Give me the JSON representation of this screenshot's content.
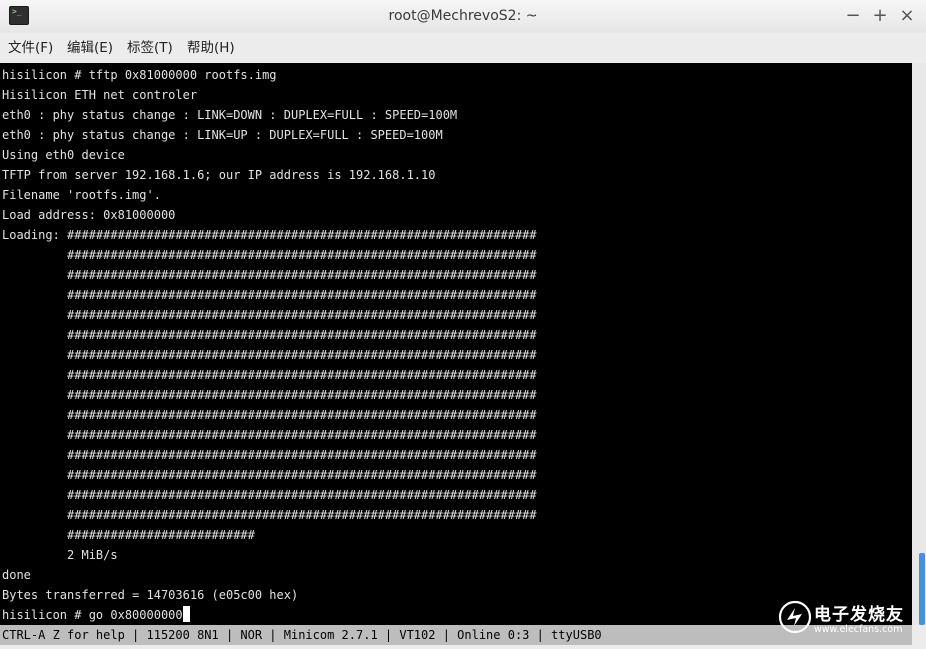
{
  "window": {
    "title": "root@MechrevoS2: ~",
    "controls": {
      "minimize": "−",
      "maximize": "+",
      "close": "×"
    }
  },
  "menubar": {
    "items": [
      {
        "label": "文件(F)"
      },
      {
        "label": "编辑(E)"
      },
      {
        "label": "标签(T)"
      },
      {
        "label": "帮助(H)"
      }
    ]
  },
  "terminal": {
    "lines": [
      "hisilicon # tftp 0x81000000 rootfs.img",
      "Hisilicon ETH net controler",
      "eth0 : phy status change : LINK=DOWN : DUPLEX=FULL : SPEED=100M",
      "eth0 : phy status change : LINK=UP : DUPLEX=FULL : SPEED=100M",
      "Using eth0 device",
      "TFTP from server 192.168.1.6; our IP address is 192.168.1.10",
      "Filename 'rootfs.img'.",
      "Load address: 0x81000000",
      "Loading: #################################################################",
      "         #################################################################",
      "         #################################################################",
      "         #################################################################",
      "         #################################################################",
      "         #################################################################",
      "         #################################################################",
      "         #################################################################",
      "         #################################################################",
      "         #################################################################",
      "         #################################################################",
      "         #################################################################",
      "         #################################################################",
      "         #################################################################",
      "         #################################################################",
      "         ##########################",
      "         2 MiB/s",
      "done",
      "Bytes transferred = 14703616 (e05c00 hex)",
      "hisilicon # go 0x80000000"
    ]
  },
  "statusbar": {
    "text": "CTRL-A Z for help | 115200 8N1 | NOR | Minicom 2.7.1 | VT102 | Online 0:3 | ttyUSB0"
  },
  "watermark": {
    "title": "电子发烧友",
    "url": "www.elecfans.com"
  },
  "colors": {
    "terminal_bg": "#000000",
    "terminal_fg": "#e2e2e2",
    "statusbar_bg": "#bdbdbd",
    "scroll_thumb": "#4a90d9"
  },
  "icons": {
    "app": "terminal-icon",
    "watermark": "elecfans-logo-icon"
  }
}
